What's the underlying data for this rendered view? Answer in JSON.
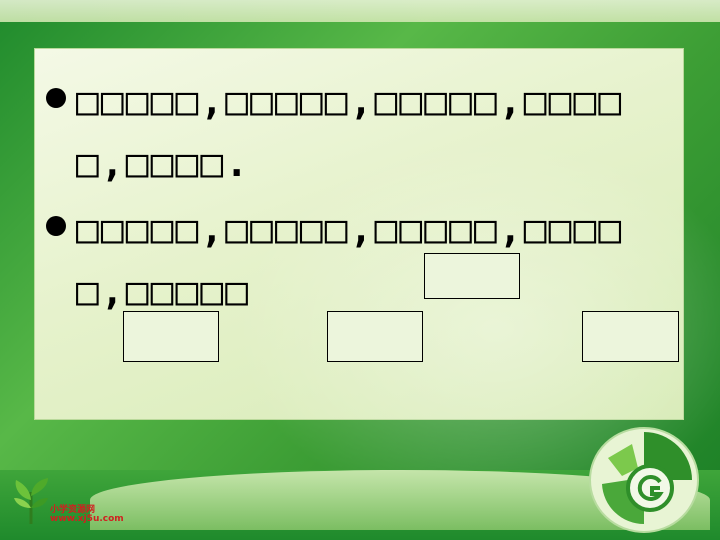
{
  "slide": {
    "bullet_1": "□□□□□,□□□□□,□□□□□,□□□□□,□□□□.",
    "bullet_2": "□□□□□,□□□□□,□□□□□,□□□□□,□□□□□"
  },
  "footer": {
    "logo_name": "小学资源网",
    "logo_url": "www.xj5u.com",
    "logo_icon": "sprout-icon",
    "emblem_icon": "swirl-emblem-icon"
  },
  "colors": {
    "background_green": "#3d9e35",
    "panel": "#e6f2cc",
    "text": "#000000",
    "logo_text": "#d02020"
  }
}
